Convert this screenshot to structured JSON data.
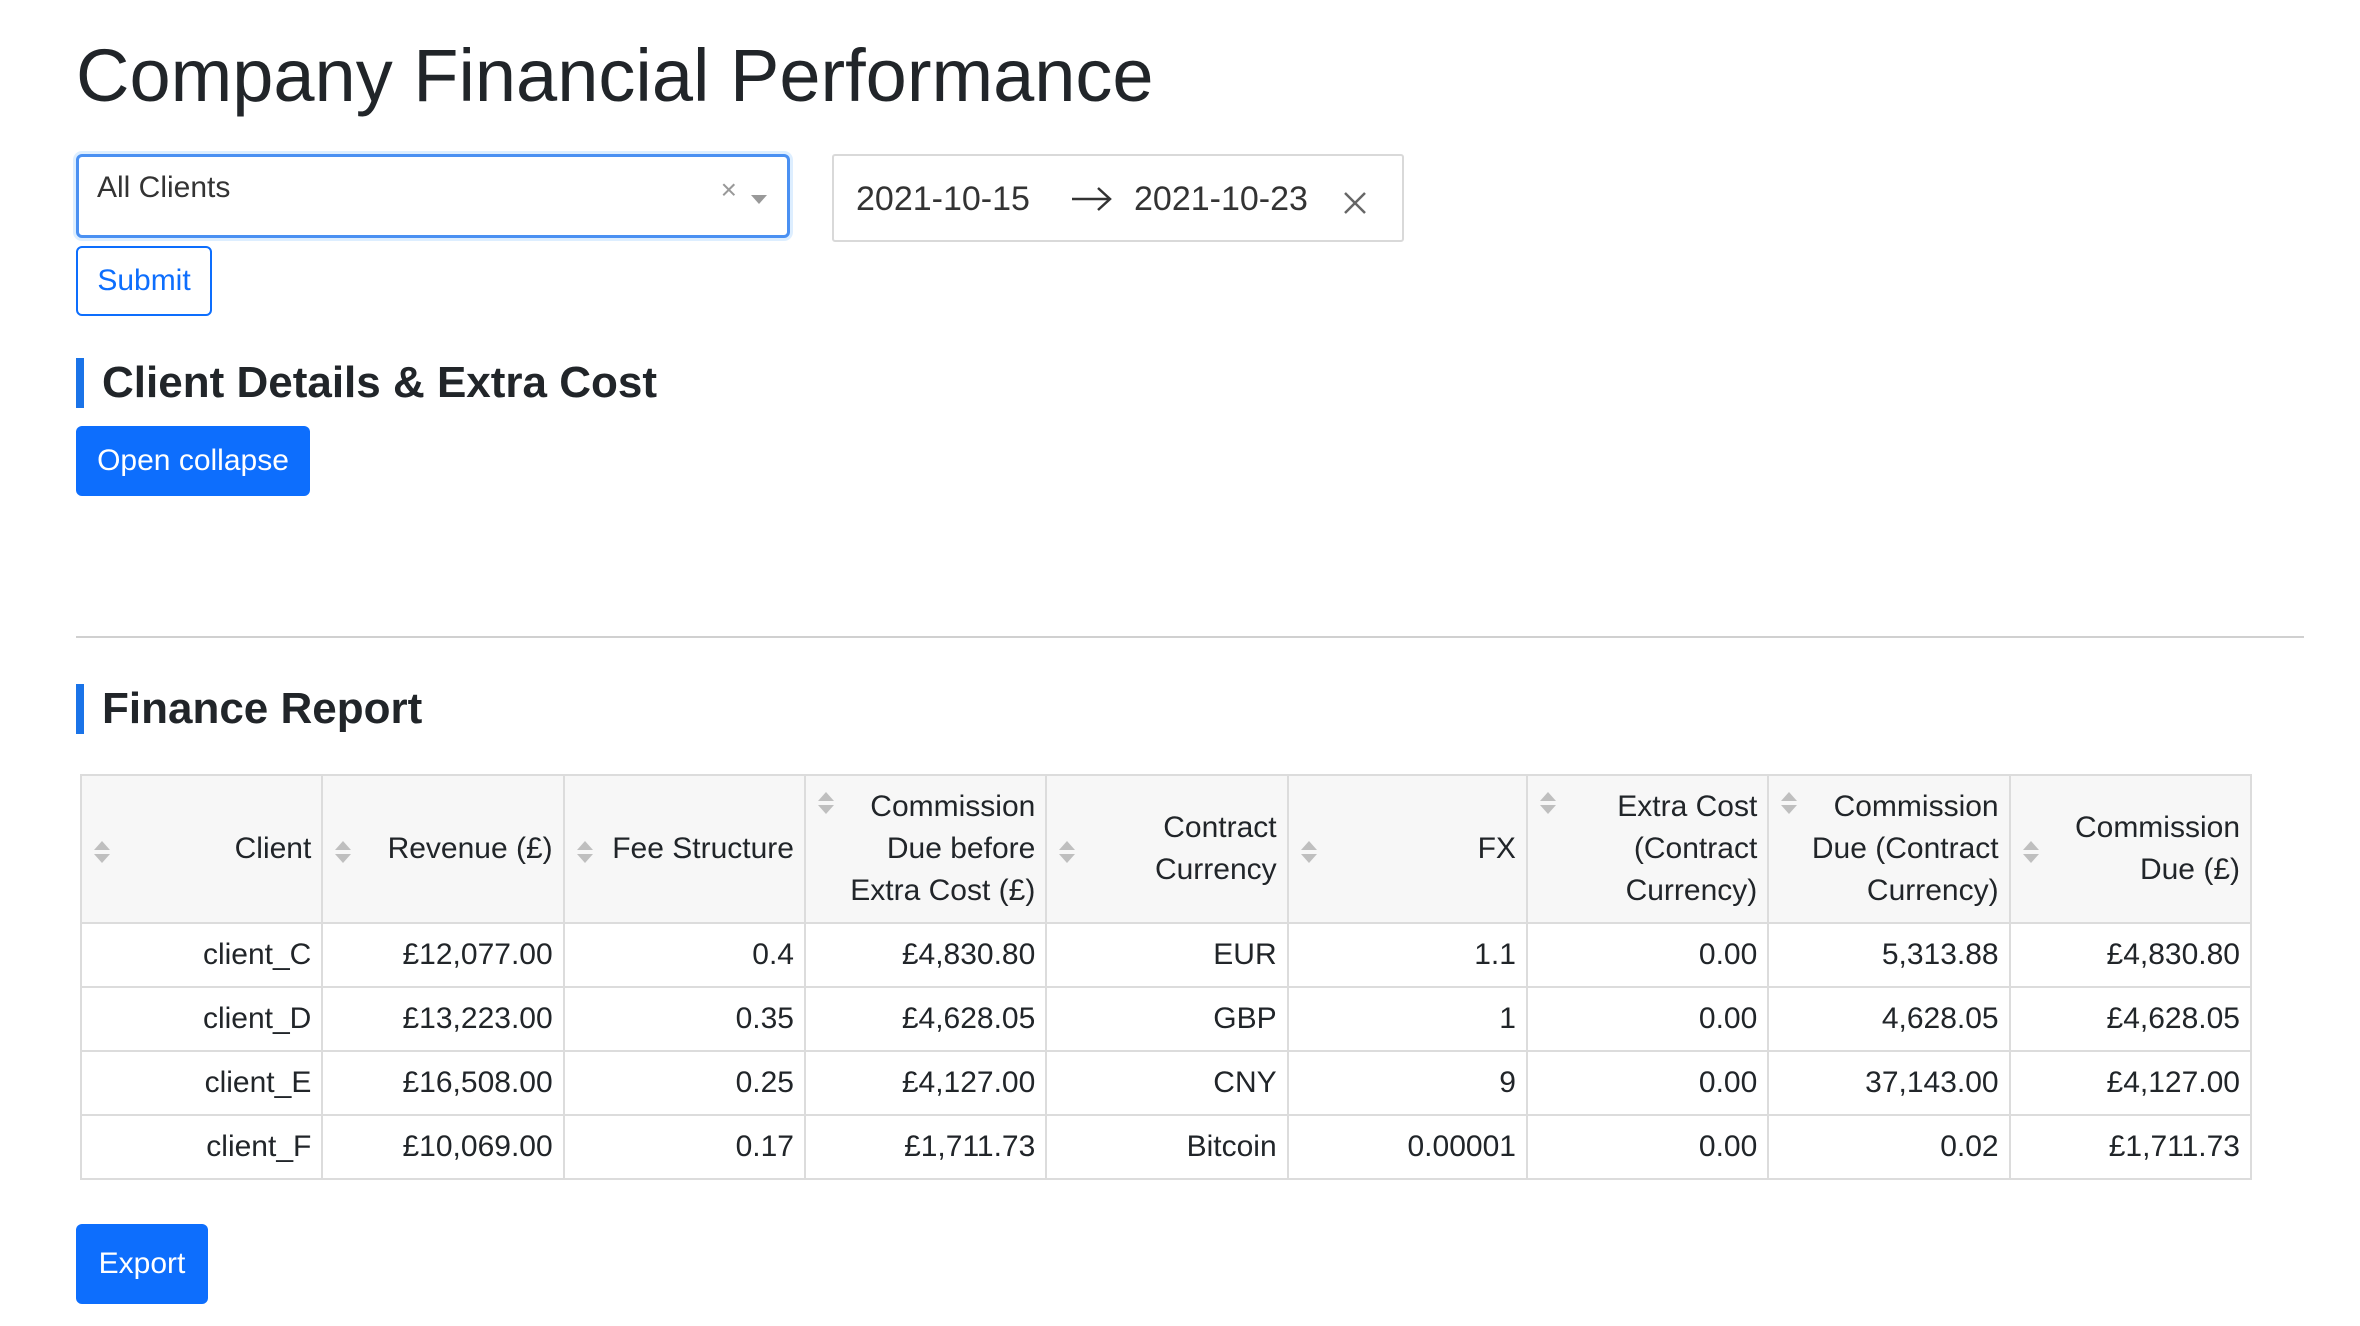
{
  "page": {
    "title": "Company Financial Performance"
  },
  "filters": {
    "client_select": {
      "value": "All Clients"
    },
    "date_range": {
      "start": "2021-10-15",
      "end": "2021-10-23"
    },
    "submit_label": "Submit"
  },
  "client_section": {
    "heading": "Client Details & Extra Cost",
    "collapse_label": "Open collapse"
  },
  "finance_section": {
    "heading": "Finance Report",
    "columns": [
      "Client",
      "Revenue (£)",
      "Fee Structure",
      "Commission Due before Extra Cost (£)",
      "Contract Currency",
      "FX",
      "Extra Cost (Contract Currency)",
      "Commission Due (Contract Currency)",
      "Commission Due (£)"
    ],
    "rows": [
      [
        "client_C",
        "£12,077.00",
        "0.4",
        "£4,830.80",
        "EUR",
        "1.1",
        "0.00",
        "5,313.88",
        "£4,830.80"
      ],
      [
        "client_D",
        "£13,223.00",
        "0.35",
        "£4,628.05",
        "GBP",
        "1",
        "0.00",
        "4,628.05",
        "£4,628.05"
      ],
      [
        "client_E",
        "£16,508.00",
        "0.25",
        "£4,127.00",
        "CNY",
        "9",
        "0.00",
        "37,143.00",
        "£4,127.00"
      ],
      [
        "client_F",
        "£10,069.00",
        "0.17",
        "£1,711.73",
        "Bitcoin",
        "0.00001",
        "0.00",
        "0.02",
        "£1,711.73"
      ]
    ],
    "export_label": "Export"
  },
  "icons": {
    "clear": "clear-icon",
    "caret": "chevron-down-icon",
    "arrow": "arrow-right-icon",
    "close": "close-icon",
    "sort": "sort-icon"
  },
  "colors": {
    "accent": "#0d6efd",
    "heading_bar": "#1a73e8",
    "focus_border": "#4a90f2"
  }
}
